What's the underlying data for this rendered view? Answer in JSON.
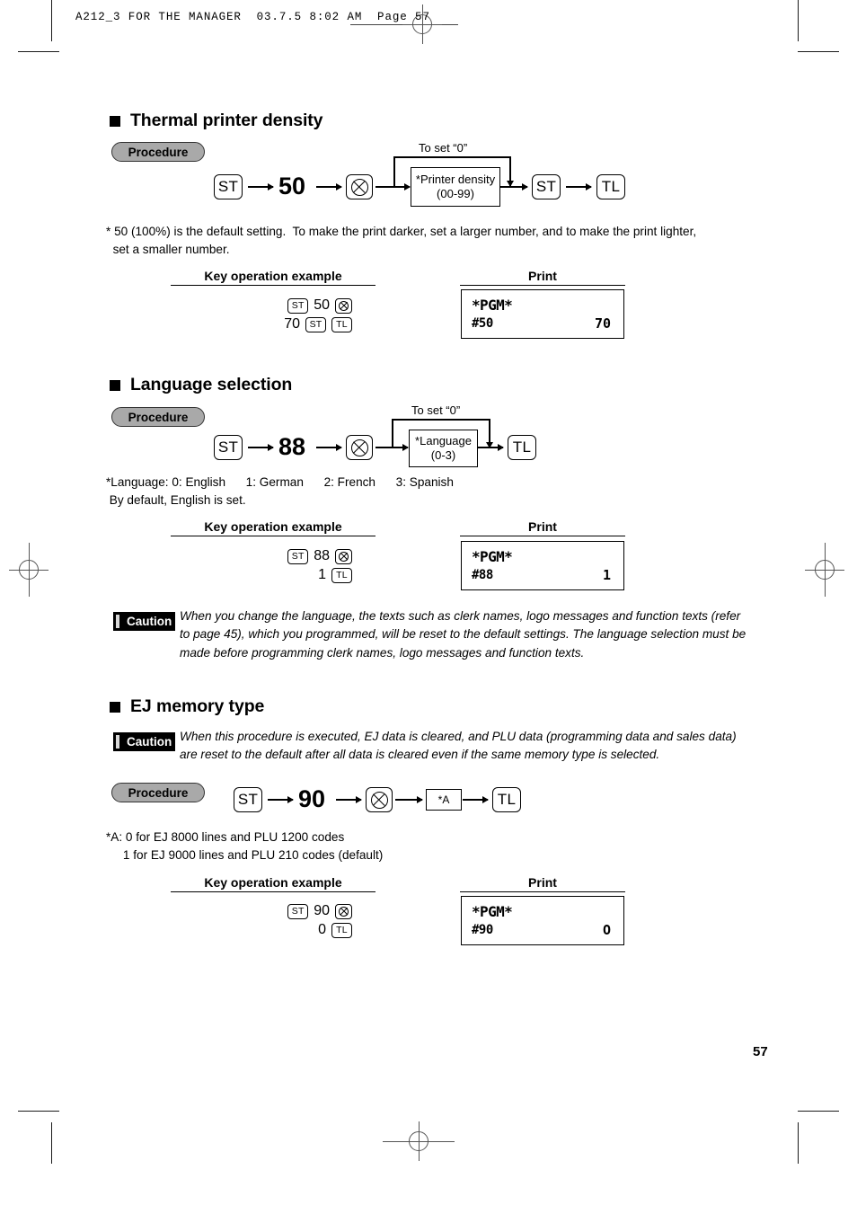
{
  "page": {
    "header_line": "A212_3 FOR THE MANAGER  03.7.5 8:02 AM  Page 57",
    "number": "57"
  },
  "labels": {
    "procedure": "Procedure",
    "key_operation_example": "Key operation example",
    "print": "Print",
    "caution": "Caution",
    "to_set_zero": "To set “0”",
    "key_st": "ST",
    "key_tl": "TL",
    "multiply_icon": "multiply-key-icon"
  },
  "sections": [
    {
      "id": "thermal-printer-density",
      "title": "Thermal printer density",
      "flow": {
        "start_key": "ST",
        "code": "50",
        "param_line1": "*Printer density",
        "param_line2": "(00-99)",
        "loop_label": "To set “0”",
        "end_keys": [
          "ST",
          "TL"
        ]
      },
      "note": "* 50 (100%) is the default setting.  To make the print darker, set a larger number, and to make the print lighter,\n  set a smaller number.",
      "example": {
        "line1_keys": [
          "ST",
          "50",
          "MULT"
        ],
        "line2_keys": [
          "70",
          "ST",
          "TL"
        ]
      },
      "print": {
        "header": "*PGM*",
        "code": "#50",
        "value": "70"
      }
    },
    {
      "id": "language-selection",
      "title": "Language selection",
      "flow": {
        "start_key": "ST",
        "code": "88",
        "param_line1": "*Language",
        "param_line2": "(0-3)",
        "loop_label": "To set “0”",
        "end_keys": [
          "TL"
        ]
      },
      "note": "*Language: 0: English      1: German      2: French      3: Spanish\n By default, English is set.",
      "example": {
        "line1_keys": [
          "ST",
          "88",
          "MULT"
        ],
        "line2_keys": [
          "1",
          "TL"
        ]
      },
      "print": {
        "header": "*PGM*",
        "code": "#88",
        "value": "1"
      },
      "caution": "When you change the language, the texts such as clerk names, logo messages and function texts (refer to page 45), which you programmed, will be reset to the default settings.  The language selection must be made before programming clerk names, logo messages and function texts."
    },
    {
      "id": "ej-memory-type",
      "title": "EJ memory type",
      "caution": "When this procedure is executed, EJ data is cleared, and PLU data (programming data and sales data) are reset to the default after all data is cleared even if the same memory type is selected.",
      "flow": {
        "start_key": "ST",
        "code": "90",
        "param_line1": "*A",
        "end_keys": [
          "TL"
        ]
      },
      "note": "*A: 0 for EJ 8000 lines and PLU 1200 codes\n     1 for EJ 9000 lines and PLU 210 codes (default)",
      "example": {
        "line1_keys": [
          "ST",
          "90",
          "MULT"
        ],
        "line2_keys": [
          "0",
          "TL"
        ]
      },
      "print": {
        "header": "*PGM*",
        "code": "#90",
        "value": "O"
      }
    }
  ]
}
